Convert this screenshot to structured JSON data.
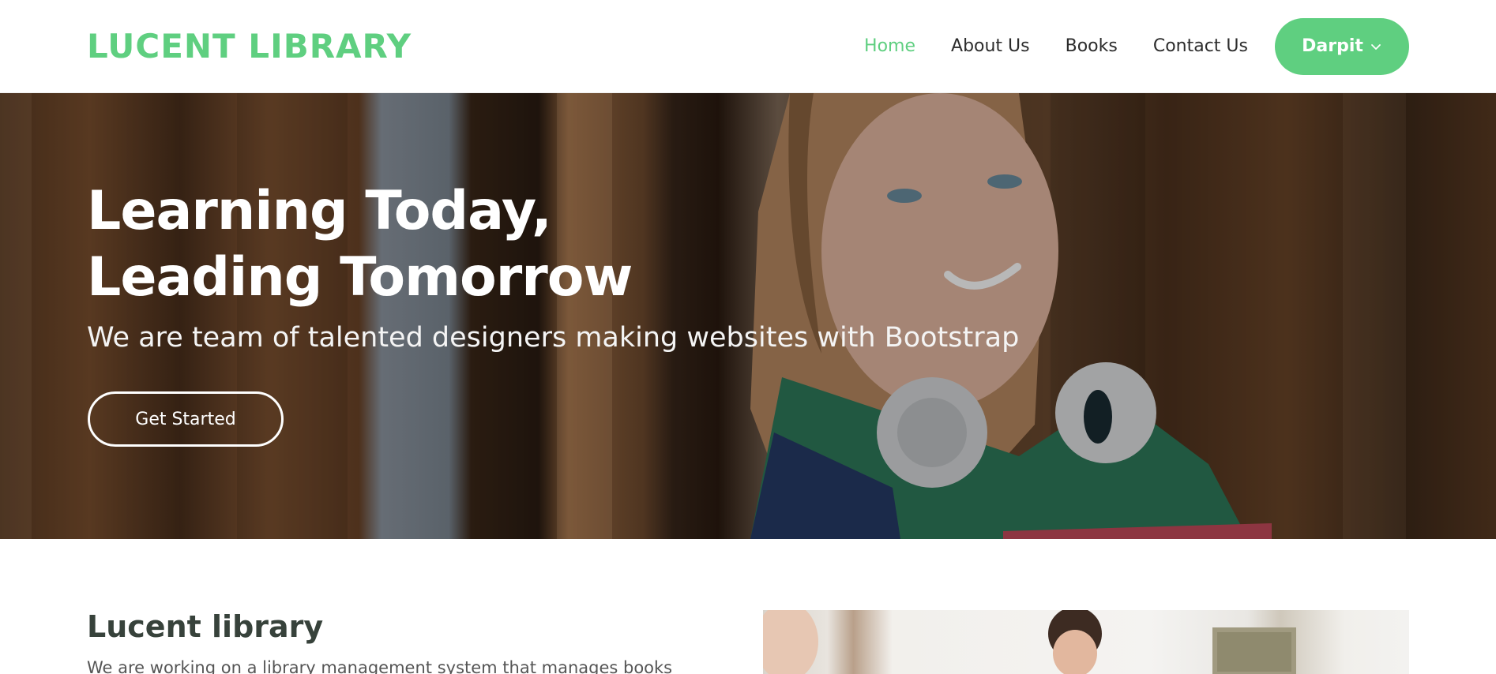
{
  "header": {
    "logo": "LUCENT LIBRARY",
    "nav": [
      "Home",
      "About Us",
      "Books",
      "Contact Us"
    ],
    "active_nav": "Home",
    "user_button": "Darpit"
  },
  "hero": {
    "title_line1": "Learning Today,",
    "title_line2": "Leading Tomorrow",
    "subtitle": "We are team of talented designers making websites with Bootstrap",
    "cta_label": "Get Started"
  },
  "about": {
    "title": "Lucent library",
    "text": "We are working on a library management system that manages books"
  },
  "colors": {
    "accent": "#5fcf80",
    "text_dark": "#2c2c2c",
    "white": "#ffffff"
  },
  "icons": {
    "user_dropdown": "chevron-down-icon"
  }
}
